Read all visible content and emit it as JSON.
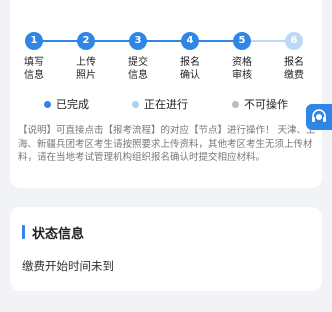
{
  "steps": [
    {
      "number": "1",
      "label": "填写\n信息"
    },
    {
      "number": "2",
      "label": "上传\n照片"
    },
    {
      "number": "3",
      "label": "提交\n信息"
    },
    {
      "number": "4",
      "label": "报名\n确认"
    },
    {
      "number": "5",
      "label": "资格\n审核"
    },
    {
      "number": "6",
      "label": "报名\n缴费"
    }
  ],
  "legend": {
    "completed": {
      "label": "已完成",
      "color": "#2f86e6"
    },
    "in_progress": {
      "label": "正在进行",
      "color": "#a9cff5"
    },
    "disabled": {
      "label": "不可操作",
      "color": "#b8bcc4"
    }
  },
  "note": "【说明】可直接点击【报考流程】的对应【节点】进行操作！ 天津、上海、新疆兵团考区考生请按照要求上传资料，其他考区考生无须上传材料，请在当地考试管理机构组织报名确认时提交相应材料。",
  "status": {
    "title": "状态信息",
    "text": "缴费开始时间未到"
  },
  "float_button": {
    "icon": "customer-service-icon"
  }
}
